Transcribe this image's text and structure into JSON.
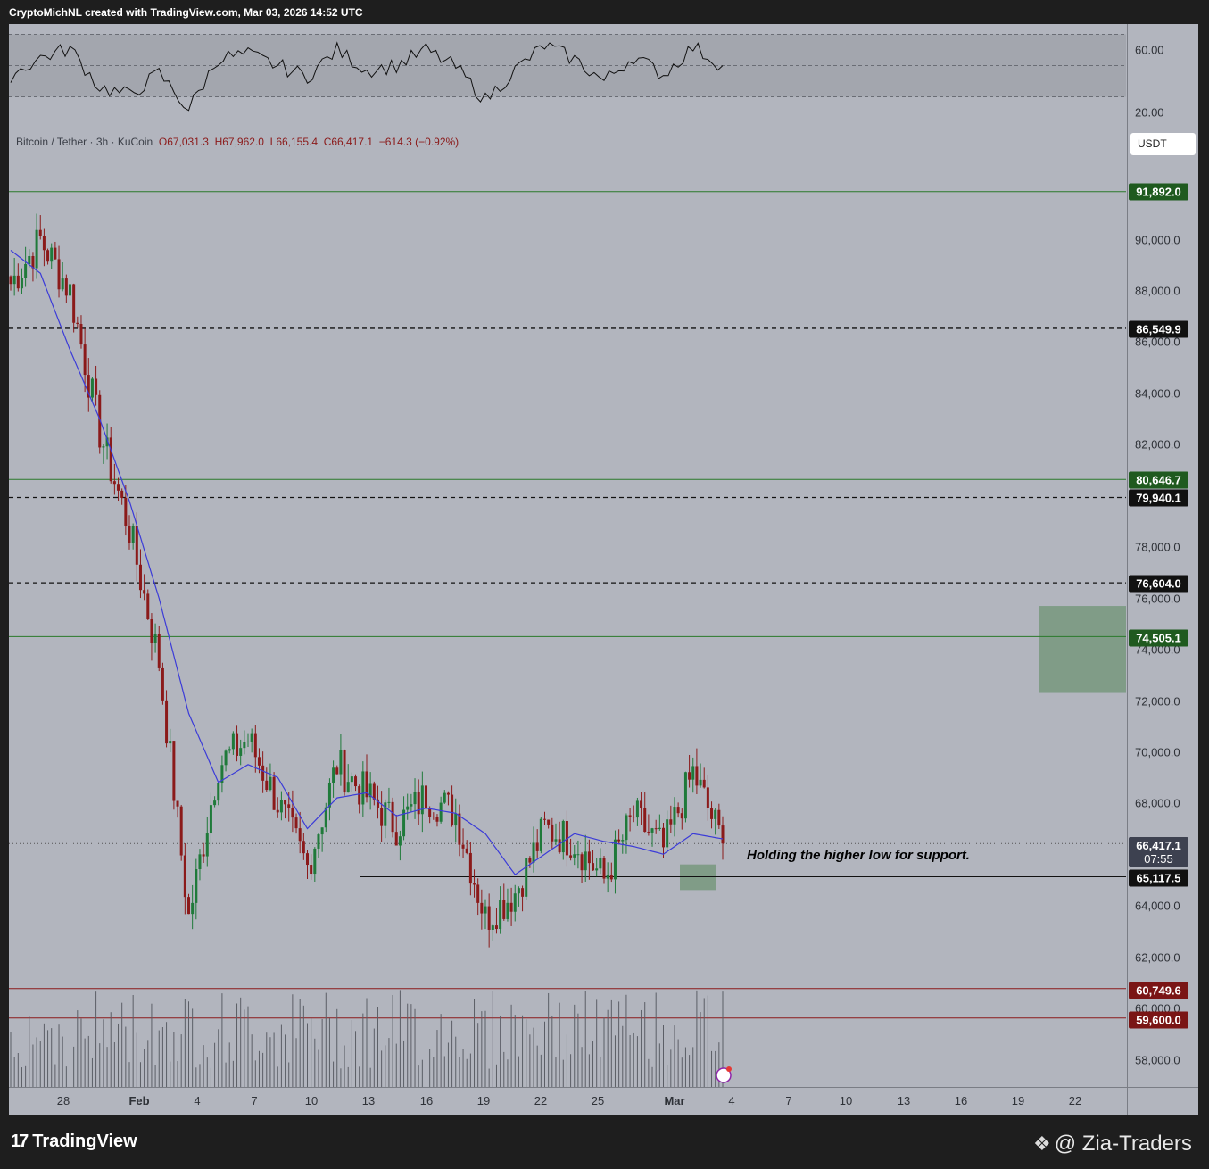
{
  "header": {
    "text": "CryptoMichNL created with TradingView.com, Mar 03, 2026 14:52 UTC"
  },
  "symbol": {
    "pair": "Bitcoin / Tether · 3h · KuCoin",
    "open": "O67,031.3",
    "high": "H67,962.0",
    "low": "L66,155.4",
    "close": "C66,417.1",
    "change": "−614.3 (−0.92%)"
  },
  "currency_button": "USDT",
  "annotation": "Holding the higher low for support.",
  "footer": {
    "logo_text": "TradingView",
    "logo_mark": "17",
    "watermark": "@ Zia-Traders",
    "watermark_icon": "binance-diamond-icon"
  },
  "rsi_axis": [
    "60.00",
    "20.00"
  ],
  "price_axis": [
    "90,000.0",
    "88,000.0",
    "86,000.0",
    "84,000.0",
    "82,000.0",
    "78,000.0",
    "76,000.0",
    "74,000.0",
    "72,000.0",
    "70,000.0",
    "68,000.0",
    "64,000.0",
    "62,000.0",
    "60,000.0",
    "58,000.0"
  ],
  "level_badges": [
    {
      "value": "91,892.0",
      "style": "green"
    },
    {
      "value": "86,549.9",
      "style": "black"
    },
    {
      "value": "80,646.7",
      "style": "green"
    },
    {
      "value": "79,940.1",
      "style": "black"
    },
    {
      "value": "76,604.0",
      "style": "black"
    },
    {
      "value": "74,505.1",
      "style": "green"
    },
    {
      "value": "65,117.5",
      "style": "black"
    },
    {
      "value": "60,749.6",
      "style": "red"
    },
    {
      "value": "59,600.0",
      "style": "red"
    }
  ],
  "last_price": {
    "value": "66,417.1",
    "countdown": "07:55"
  },
  "time_axis": [
    "28",
    "Feb",
    "4",
    "7",
    "10",
    "13",
    "16",
    "19",
    "22",
    "25",
    "Mar",
    "4",
    "7",
    "10",
    "13",
    "16",
    "19",
    "22"
  ],
  "colors": {
    "up": "#1f7a3a",
    "down": "#8b1a1a",
    "ma": "#3b3bd8",
    "green_level": "#2a7a2a",
    "red_level": "#8b1a1a",
    "zone": "#6f9474"
  },
  "chart_data": {
    "type": "candlestick",
    "title": "",
    "xlabel": "",
    "ylabel": "",
    "ylim": [
      56800,
      93500
    ],
    "x": [
      "Jan 26",
      "Jan 28",
      "Jan 30",
      "Feb 1",
      "Feb 3",
      "Feb 5",
      "Feb 6",
      "Feb 7",
      "Feb 9",
      "Feb 11",
      "Feb 12",
      "Feb 14",
      "Feb 16",
      "Feb 18",
      "Feb 20",
      "Feb 22",
      "Feb 23",
      "Feb 24",
      "Feb 25",
      "Feb 26",
      "Feb 27",
      "Feb 28",
      "Mar 1",
      "Mar 2",
      "Mar 3"
    ],
    "close": [
      88300,
      90000,
      88000,
      82500,
      78700,
      73500,
      63500,
      69500,
      70500,
      68000,
      65500,
      69500,
      68300,
      67100,
      68300,
      67600,
      63500,
      64500,
      67000,
      66500,
      65000,
      67500,
      66200,
      69200,
      66417
    ],
    "moving_average": [
      89600,
      88700,
      85700,
      83000,
      79800,
      76000,
      71500,
      68800,
      69500,
      69000,
      67000,
      68200,
      68400,
      67500,
      67800,
      67600,
      66800,
      65200,
      66000,
      66800,
      66500,
      66300,
      66000,
      66800,
      66600
    ],
    "horizontal_levels": [
      {
        "price": 91892.0,
        "style": "solid",
        "color": "green"
      },
      {
        "price": 86549.9,
        "style": "dashed",
        "color": "black"
      },
      {
        "price": 80646.7,
        "style": "solid",
        "color": "green"
      },
      {
        "price": 79940.1,
        "style": "dashed",
        "color": "black"
      },
      {
        "price": 76604.0,
        "style": "dashed",
        "color": "black"
      },
      {
        "price": 74505.1,
        "style": "solid",
        "color": "green"
      },
      {
        "price": 65117.5,
        "style": "solid",
        "color": "black"
      },
      {
        "price": 60749.6,
        "style": "solid",
        "color": "red"
      },
      {
        "price": 59600.0,
        "style": "solid",
        "color": "red"
      }
    ],
    "zones": [
      {
        "name": "target-zone",
        "from_price": 72300,
        "to_price": 75700
      },
      {
        "name": "support-zone",
        "from_price": 64600,
        "to_price": 65600
      }
    ],
    "rsi": {
      "ylim": [
        10,
        70
      ],
      "bands": [
        30,
        50,
        70
      ],
      "values": [
        44,
        55,
        61,
        36,
        31,
        45,
        22,
        55,
        57,
        50,
        43,
        60,
        47,
        50,
        60,
        49,
        28,
        47,
        63,
        54,
        40,
        56,
        44,
        62,
        50
      ]
    }
  }
}
